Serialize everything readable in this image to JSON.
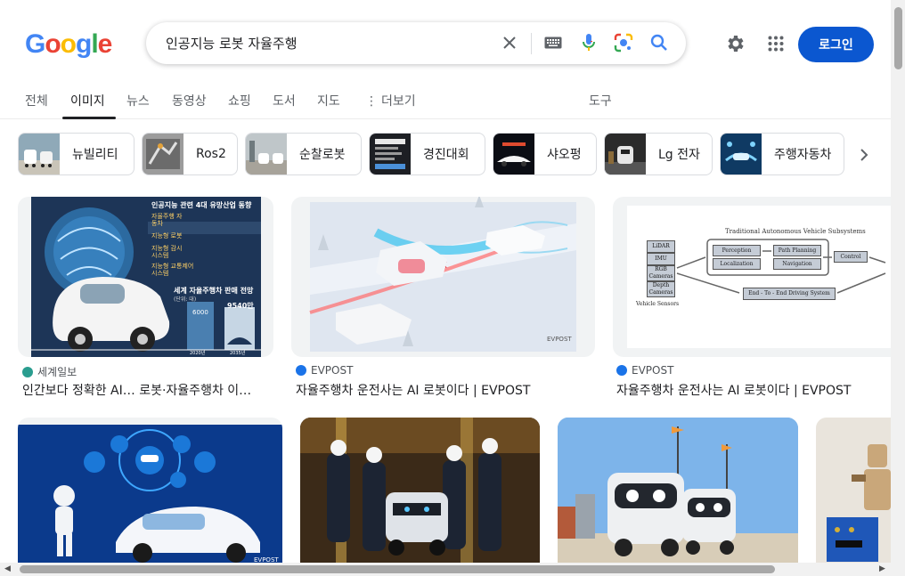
{
  "logo": "Google",
  "search": {
    "query": "인공지능 로봇 자율주행"
  },
  "header": {
    "login_label": "로그인"
  },
  "tabs": [
    "전체",
    "이미지",
    "뉴스",
    "동영상",
    "쇼핑",
    "도서",
    "지도",
    "더보기",
    "도구"
  ],
  "chips": [
    {
      "label": "뉴빌리티"
    },
    {
      "label": "Ros2"
    },
    {
      "label": "순찰로봇"
    },
    {
      "label": "경진대회"
    },
    {
      "label": "샤오펑"
    },
    {
      "label": "Lg 전자"
    },
    {
      "label": "주행자동차"
    }
  ],
  "results": [
    {
      "source": "세계일보",
      "title": "인간보다 정확한 AI… 로봇·자율주행차 이…"
    },
    {
      "source": "EVPOST",
      "title": "자율주행차 운전사는 AI 로봇이다 | EVPOST"
    },
    {
      "source": "EVPOST",
      "title": "자율주행차 운전사는 AI 로봇이다 | EVPOST"
    }
  ],
  "image1": {
    "heading": "인공지능 관련 4대 유망산업 동향",
    "rows": [
      "자율주행 자동차",
      "지능형 로봇",
      "지능형 감시 시스템",
      "지능형 교통제어 시스템"
    ],
    "chart_title": "세계 자율주행차 판매 전망",
    "unit": "(단위: 대)",
    "bar1_value": "6000",
    "bar2_value": "9540만",
    "year1": "2020년",
    "year2": "2035년"
  },
  "image3": {
    "title": "Traditional Autonomous Vehicle Subsystems",
    "sensors": [
      "LiDAR",
      "IMU",
      "RGB Cameras",
      "Depth Cameras"
    ],
    "sensors_label": "Vehicle Sensors",
    "blocks": [
      "Perception",
      "Localization",
      "Path Planning",
      "Navigation",
      "Control"
    ],
    "e2e": "End - To - End Driving System"
  },
  "watermark": "EVPOST"
}
